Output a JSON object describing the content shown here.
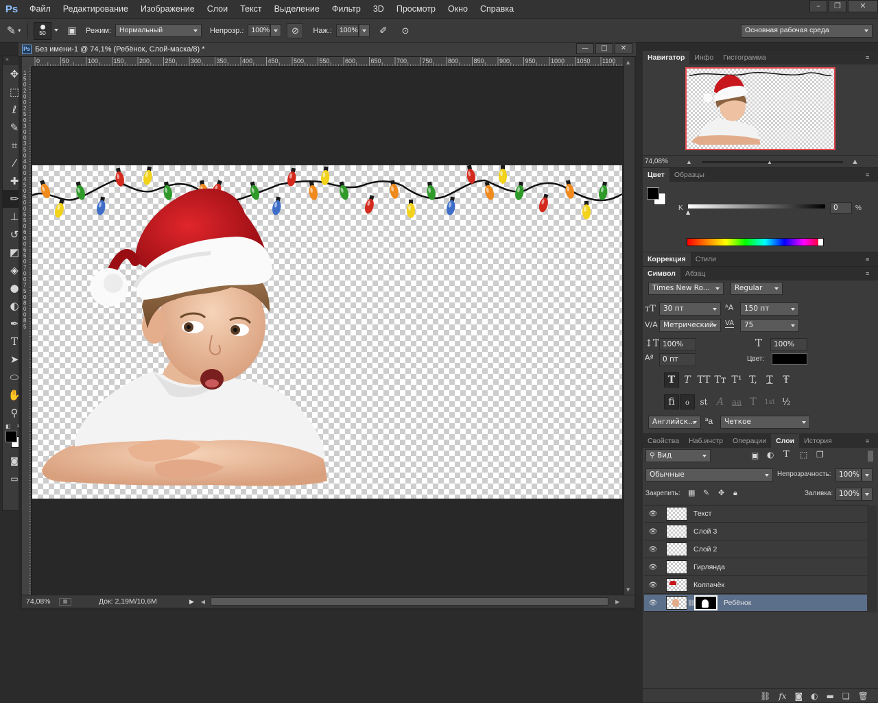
{
  "menubar": {
    "logo": "Ps",
    "items": [
      "Файл",
      "Редактирование",
      "Изображение",
      "Слои",
      "Текст",
      "Выделение",
      "Фильтр",
      "3D",
      "Просмотр",
      "Окно",
      "Справка"
    ],
    "minimize": "–",
    "restore": "❐",
    "close": "✕"
  },
  "options": {
    "brush_size": "50",
    "mode_label": "Режим:",
    "mode_value": "Нормальный",
    "opacity_label": "Непрозр.:",
    "opacity_value": "100%",
    "pressure_label": "Наж.:",
    "pressure_value": "100%",
    "workspace": "Основная рабочая среда"
  },
  "document": {
    "title": "Без имени-1 @ 74,1% (Ребёнок, Слой-маска/8) *",
    "ps_icon": "Ps",
    "btn_min": "—",
    "btn_max": "□",
    "btn_close": "✕",
    "ruler_h": [
      "0",
      "50",
      "100",
      "150",
      "200",
      "250",
      "300",
      "350",
      "400",
      "450",
      "500",
      "550",
      "600",
      "650",
      "700",
      "750",
      "800",
      "850",
      "900",
      "950",
      "1000",
      "1050",
      "1100",
      "1"
    ],
    "ruler_v": [
      "1",
      "5",
      "0",
      "2",
      "0",
      "0",
      "2",
      "5",
      "0",
      "3",
      "0",
      "0",
      "3",
      "5",
      "0",
      "4",
      "0",
      "0",
      "4",
      "5",
      "0",
      "5",
      "0",
      "0",
      "5",
      "5",
      "0",
      "6",
      "0",
      "0",
      "6",
      "5",
      "0",
      "7",
      "0",
      "0",
      "7",
      "5",
      "0",
      "8",
      "0",
      "0",
      "8",
      "5"
    ],
    "zoom": "74,08%",
    "doc_size": "Док: 2,19M/10,6M"
  },
  "navigator": {
    "tabs": [
      "Навигатор",
      "Инфо",
      "Гистограмма"
    ],
    "zoom": "74,08%"
  },
  "color": {
    "tabs": [
      "Цвет",
      "Образцы"
    ],
    "channel": "K",
    "value": "0",
    "unit": "%"
  },
  "correction": {
    "tabs": [
      "Коррекция",
      "Стили"
    ]
  },
  "symbol": {
    "tabs": [
      "Символ",
      "Абзац"
    ],
    "font_family": "Times New Ro...",
    "font_style": "Regular",
    "size": "30 пт",
    "leading": "150 пт",
    "kerning": "Метрический",
    "tracking": "75",
    "vscale": "100%",
    "hscale": "100%",
    "baseline": "0 пт",
    "color_label": "Цвет:",
    "language": "Английск...",
    "aa_label": "a",
    "antialias": "Четкое",
    "style_buttons": [
      "T",
      "T",
      "TT",
      "Tт",
      "T¹",
      "T,",
      "T",
      "Ŧ"
    ],
    "ot_buttons": [
      "ﬁ",
      "ℴ",
      "st",
      "A",
      "aa",
      "T",
      "1st",
      "½"
    ]
  },
  "layers": {
    "tabs": [
      "Свойства",
      "Наб.инстр",
      "Операции",
      "Слои",
      "История"
    ],
    "filter": "Вид",
    "blend": "Обычные",
    "opacity_label": "Непрозрачность:",
    "opacity": "100%",
    "lock_label": "Закрепить:",
    "fill_label": "Заливка:",
    "fill": "100%",
    "items": [
      {
        "name": "Текст"
      },
      {
        "name": "Слой 3"
      },
      {
        "name": "Слой 2"
      },
      {
        "name": "Гирлянда"
      },
      {
        "name": "Колпачёк"
      },
      {
        "name": "Ребёнок"
      }
    ]
  },
  "colors": {
    "accent_selected": "#5b6f8b",
    "bulbs": [
      "#f08a1c",
      "#2f9a2a",
      "#f2d21a",
      "#d42a1e",
      "#3f6ec8"
    ]
  }
}
